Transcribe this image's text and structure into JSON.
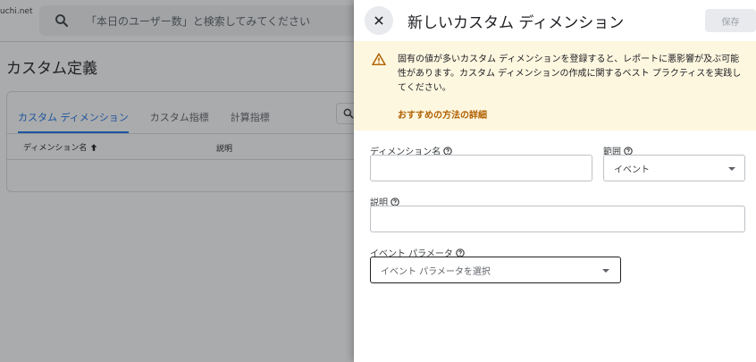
{
  "background": {
    "account": "uchi.net",
    "search_placeholder": "「本日のユーザー数」と検索してみてください",
    "page_title": "カスタム定義",
    "tabs": [
      {
        "label": "カスタム ディメンション",
        "active": true
      },
      {
        "label": "カスタム指標",
        "active": false
      },
      {
        "label": "計算指標",
        "active": false
      }
    ],
    "columns": {
      "name": "ディメンション名",
      "description": "説明"
    }
  },
  "panel": {
    "title": "新しいカスタム ディメンション",
    "save_label": "保存",
    "warning": {
      "text": "固有の値が多いカスタム ディメンションを登録すると、レポートに悪影響が及ぶ可能性があります。カスタム ディメンションの作成に関するベスト プラクティスを実践してください。",
      "link": "おすすめの方法の詳細"
    },
    "fields": {
      "dimension_name_label": "ディメンション名",
      "dimension_name_value": "",
      "scope_label": "範囲",
      "scope_value": "イベント",
      "description_label": "説明",
      "description_value": "",
      "event_param_label": "イベント パラメータ",
      "event_param_placeholder": "イベント パラメータを選択"
    }
  },
  "colors": {
    "accent": "#1a73e8",
    "warning_bg": "#fef7e0",
    "warning_icon": "#b06000"
  }
}
